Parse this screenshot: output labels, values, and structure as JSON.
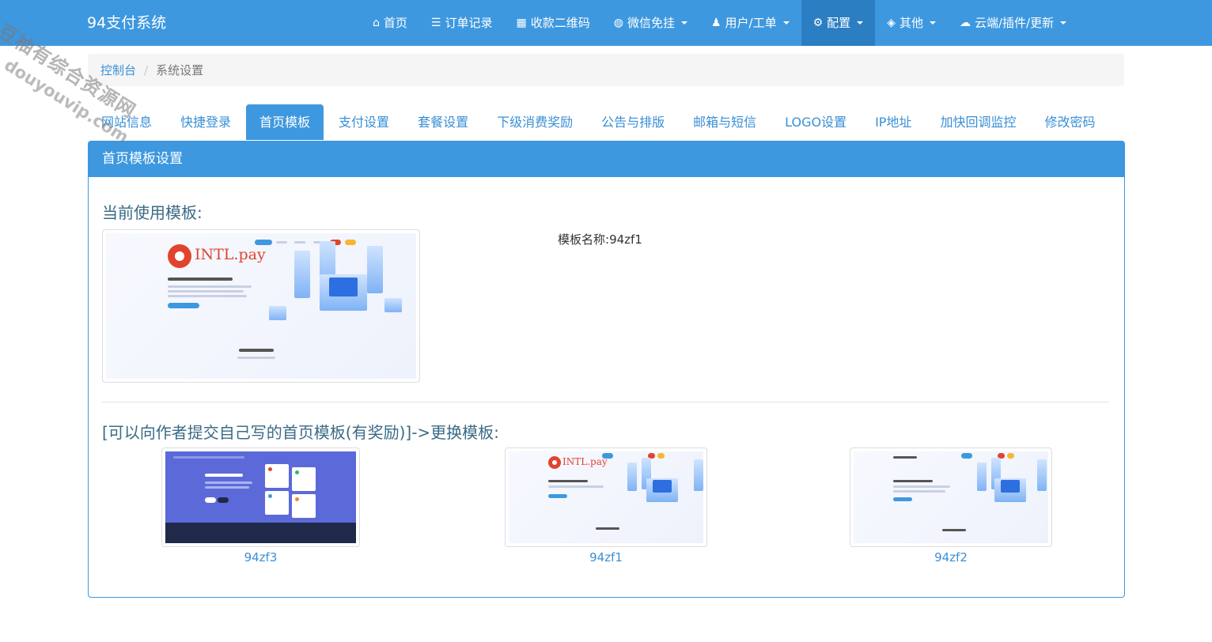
{
  "app": {
    "brand": "94支付系统"
  },
  "nav": [
    {
      "icon": "home-icon",
      "glyph": "⌂",
      "label": "首页",
      "dropdown": false,
      "active": false
    },
    {
      "icon": "list-icon",
      "glyph": "☰",
      "label": "订单记录",
      "dropdown": false,
      "active": false
    },
    {
      "icon": "qrcode-icon",
      "glyph": "▦",
      "label": "收款二维码",
      "dropdown": false,
      "active": false
    },
    {
      "icon": "wechat-icon",
      "glyph": "◍",
      "label": "微信免挂",
      "dropdown": true,
      "active": false
    },
    {
      "icon": "user-icon",
      "glyph": "♟",
      "label": "用户/工单",
      "dropdown": true,
      "active": false
    },
    {
      "icon": "gear-icon",
      "glyph": "⚙",
      "label": "配置",
      "dropdown": true,
      "active": true
    },
    {
      "icon": "cube-icon",
      "glyph": "◈",
      "label": "其他",
      "dropdown": true,
      "active": false
    },
    {
      "icon": "cloud-icon",
      "glyph": "☁",
      "label": "云端/插件/更新",
      "dropdown": true,
      "active": false
    }
  ],
  "breadcrumb": {
    "home": "控制台",
    "separator": "/",
    "current": "系统设置"
  },
  "tabs": [
    {
      "label": "网站信息",
      "active": false
    },
    {
      "label": "快捷登录",
      "active": false
    },
    {
      "label": "首页模板",
      "active": true
    },
    {
      "label": "支付设置",
      "active": false
    },
    {
      "label": "套餐设置",
      "active": false
    },
    {
      "label": "下级消费奖励",
      "active": false
    },
    {
      "label": "公告与排版",
      "active": false
    },
    {
      "label": "邮箱与短信",
      "active": false
    },
    {
      "label": "LOGO设置",
      "active": false
    },
    {
      "label": "IP地址",
      "active": false
    },
    {
      "label": "加快回调监控",
      "active": false
    },
    {
      "label": "修改密码",
      "active": false
    }
  ],
  "panel": {
    "title": "首页模板设置",
    "current_heading": "当前使用模板:",
    "current_name_label": "模板名称:",
    "current_name_value": "94zf1",
    "change_heading": "[可以向作者提交自己写的首页模板(有奖励)]->更换模板:",
    "preview_brand": "INTL.pay",
    "templates": [
      {
        "name": "94zf3",
        "style": "dark"
      },
      {
        "name": "94zf1",
        "style": "intl"
      },
      {
        "name": "94zf2",
        "style": "light"
      }
    ]
  },
  "watermark": {
    "line1": "豆柚有综合资源网",
    "line2": "douyouvip.com"
  },
  "colors": {
    "primary": "#3e98df",
    "primary_dark": "#2b7ec2",
    "link": "#3a8fd6",
    "heading": "#3a6b86"
  }
}
